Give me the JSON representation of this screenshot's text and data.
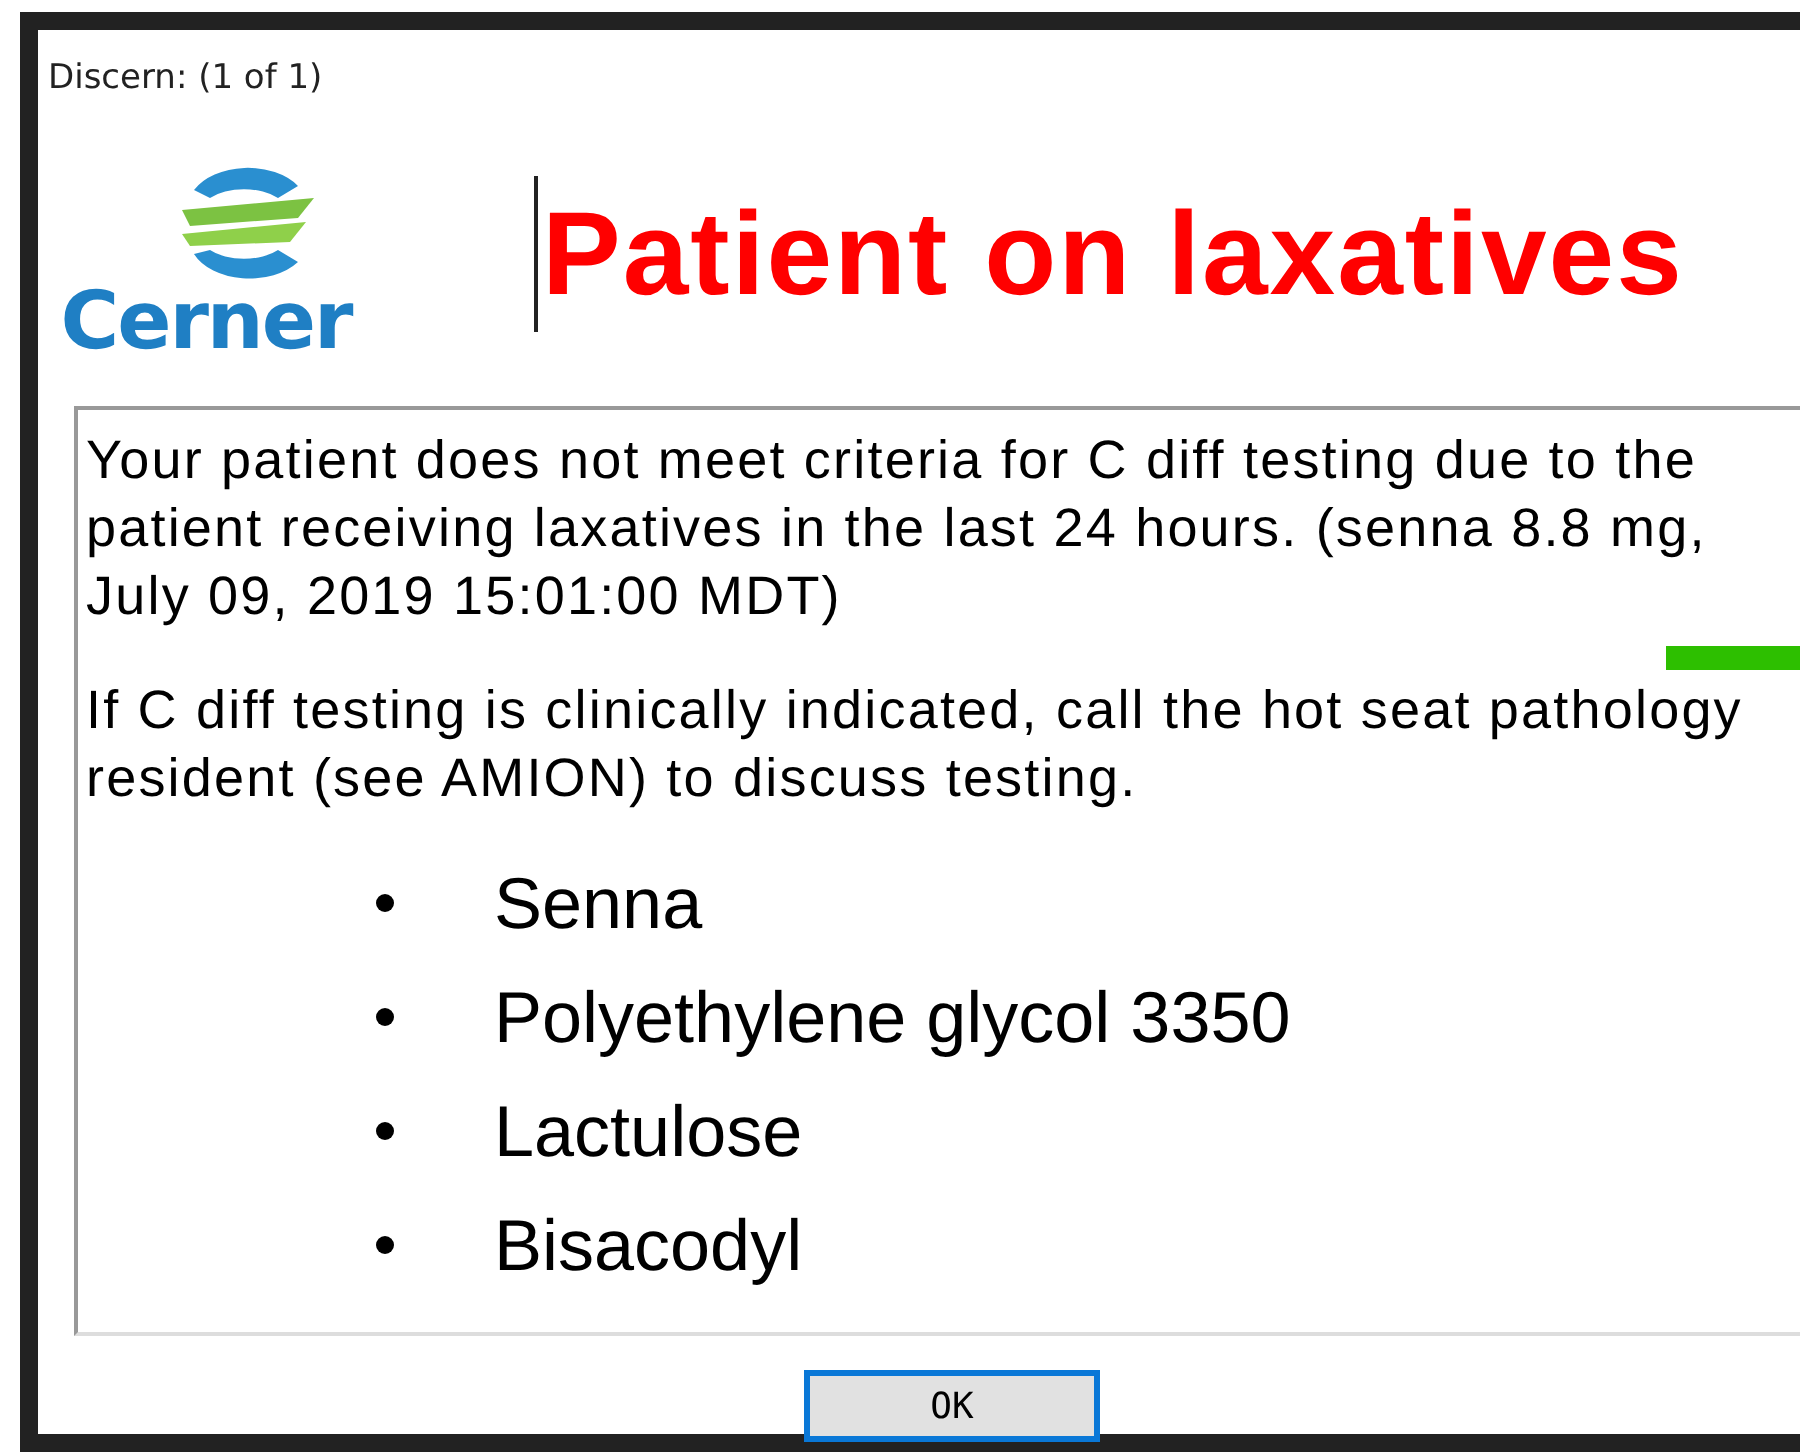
{
  "window": {
    "title": "Discern:  (1 of 1)"
  },
  "logo": {
    "wordmark": "Cerner"
  },
  "alert_title": "Patient on laxatives",
  "message": {
    "paragraphs": [
      [
        "Your patient does not meet criteria for C diff testing due to the",
        "patient receiving laxatives in the last 24 hours. (senna 8.8 mg,",
        "July 09, 2019 15:01:00 MDT)"
      ],
      [
        "If C diff testing is clinically indicated, call the hot seat pathology",
        "resident (see AMION) to discuss  testing."
      ]
    ]
  },
  "laxatives": [
    "Senna",
    "Polyethylene glycol 3350",
    "Lactulose",
    "Bisacodyl"
  ],
  "buttons": [
    {
      "label": "OK",
      "selected": true
    }
  ]
}
